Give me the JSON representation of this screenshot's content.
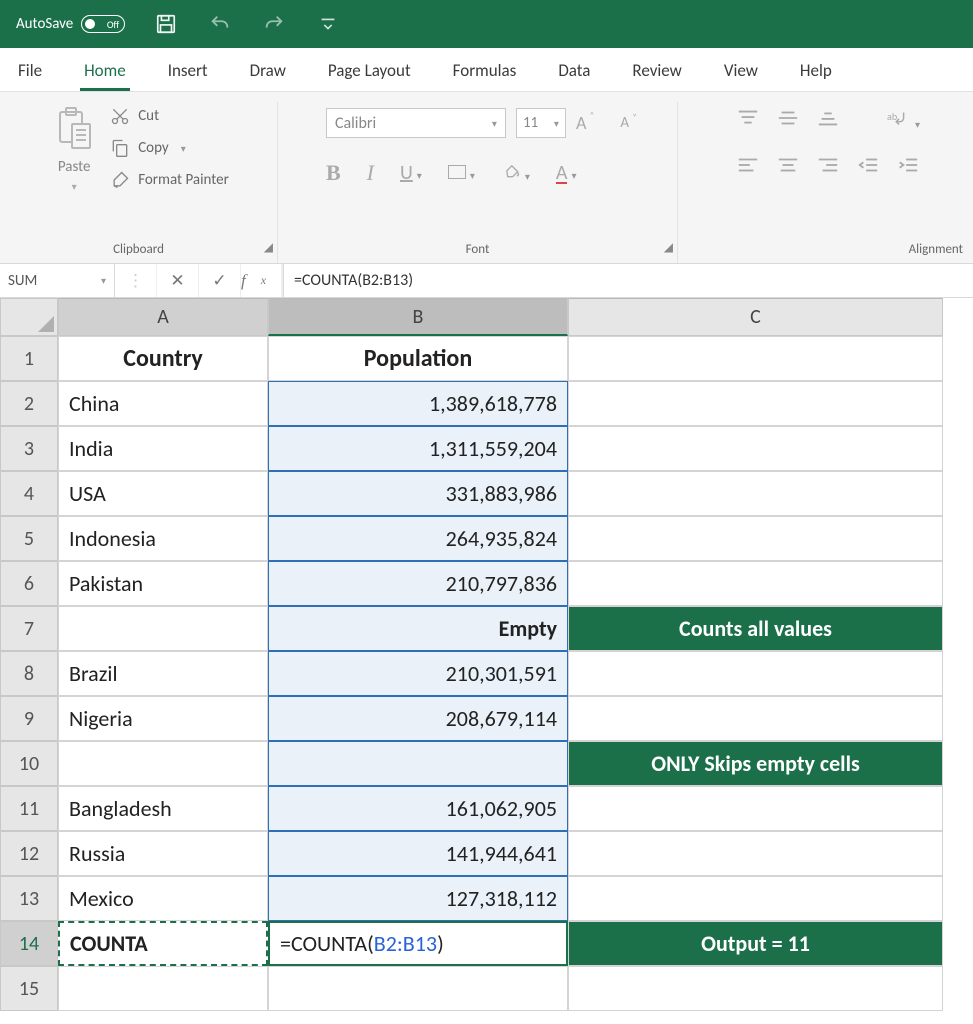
{
  "title_bar": {
    "autosave_label": "AutoSave",
    "autosave_state": "Off"
  },
  "tabs": [
    "File",
    "Home",
    "Insert",
    "Draw",
    "Page Layout",
    "Formulas",
    "Data",
    "Review",
    "View",
    "Help"
  ],
  "active_tab": "Home",
  "ribbon": {
    "clipboard": {
      "paste_label": "Paste",
      "cut_label": "Cut",
      "copy_label": "Copy",
      "fp_label": "Format Painter",
      "group_label": "Clipboard"
    },
    "font": {
      "font_name": "Calibri",
      "font_size": "11",
      "group_label": "Font"
    },
    "alignment": {
      "group_label": "Alignment"
    }
  },
  "name_box": "SUM",
  "formula_bar": "=COUNTA(B2:B13)",
  "columns": [
    "A",
    "B",
    "C"
  ],
  "sheet": {
    "headers": {
      "A": "Country",
      "B": "Population"
    },
    "rows": [
      {
        "n": 2,
        "A": "China",
        "B": "1,389,618,778",
        "C": ""
      },
      {
        "n": 3,
        "A": "India",
        "B": "1,311,559,204",
        "C": ""
      },
      {
        "n": 4,
        "A": "USA",
        "B": "331,883,986",
        "C": ""
      },
      {
        "n": 5,
        "A": "Indonesia",
        "B": "264,935,824",
        "C": ""
      },
      {
        "n": 6,
        "A": "Pakistan",
        "B": "210,797,836",
        "C": ""
      },
      {
        "n": 7,
        "A": "",
        "B": "Empty",
        "C": "Counts all values",
        "b_bold": true,
        "c_note": true
      },
      {
        "n": 8,
        "A": "Brazil",
        "B": "210,301,591",
        "C": ""
      },
      {
        "n": 9,
        "A": "Nigeria",
        "B": "208,679,114",
        "C": ""
      },
      {
        "n": 10,
        "A": "",
        "B": "",
        "C": "ONLY Skips empty cells",
        "c_note": true
      },
      {
        "n": 11,
        "A": "Bangladesh",
        "B": "161,062,905",
        "C": ""
      },
      {
        "n": 12,
        "A": "Russia",
        "B": "141,944,641",
        "C": ""
      },
      {
        "n": 13,
        "A": "Mexico",
        "B": "127,318,112",
        "C": ""
      }
    ],
    "row14": {
      "A": "COUNTA",
      "B_prefix": "=COUNTA(",
      "B_ref": "B2:B13",
      "B_suffix": ")",
      "C": "Output = 11"
    }
  }
}
